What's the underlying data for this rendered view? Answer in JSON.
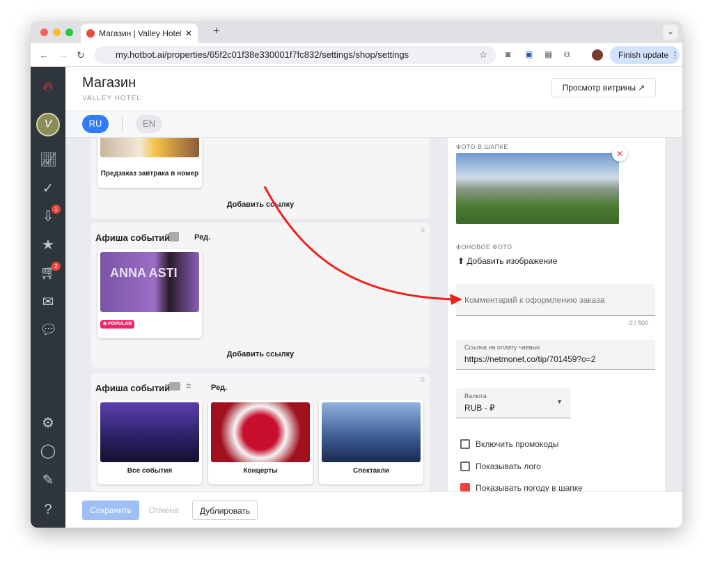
{
  "browser": {
    "tab_title": "Магазин | Valley Hotel | Hotbot",
    "url": "my.hotbot.ai/properties/65f2c01f38e330001f7fc832/settings/shop/settings",
    "finish_update": "Finish update"
  },
  "sidebar": {
    "badges": {
      "inbox": "1",
      "cart": "2"
    }
  },
  "header": {
    "title": "Магазин",
    "subtitle": "VALLEY HOTEL",
    "preview_button": "Просмотр витрины ↗"
  },
  "languages": [
    {
      "code": "RU",
      "active": true
    },
    {
      "code": "EN",
      "active": false
    }
  ],
  "blocks": [
    {
      "card": "Предзаказ завтрака в номер",
      "add_link": "Добавить ссылку"
    },
    {
      "title": "Афиша событий",
      "edit": "Ред.",
      "badge": "POPULAR",
      "add_link": "Добавить ссылку",
      "image_text": "ANNA ASTI"
    },
    {
      "title": "Афиша событий",
      "edit": "Ред.",
      "cards": [
        "Все события",
        "Концерты",
        "Спектакли"
      ]
    }
  ],
  "settings": {
    "header_photo_label": "ФОТО В ШАПКЕ",
    "bg_photo_label": "ФОНОВОЕ ФОТО",
    "add_image": "Добавить изображение",
    "comment_placeholder": "Комментарий к оформлению заказа",
    "comment_counter": "0 / 500",
    "tip_label": "Ссылка на оплату чаевых",
    "tip_value": "https://netmonet.co/tip/701459?o=2",
    "currency_label": "Валюта",
    "currency_value": "RUB - ₽",
    "checkboxes": [
      {
        "label": "Включить промокоды",
        "checked": false
      },
      {
        "label": "Показывать лого",
        "checked": false
      },
      {
        "label": "Показывать погоду в шапке",
        "checked": true
      }
    ]
  },
  "footer": {
    "save": "Сохранить",
    "cancel": "Отмена",
    "duplicate": "Дублировать"
  },
  "colors": {
    "accent": "#2f7cf6",
    "danger": "#f0443a",
    "sidebar": "#2f353c"
  }
}
